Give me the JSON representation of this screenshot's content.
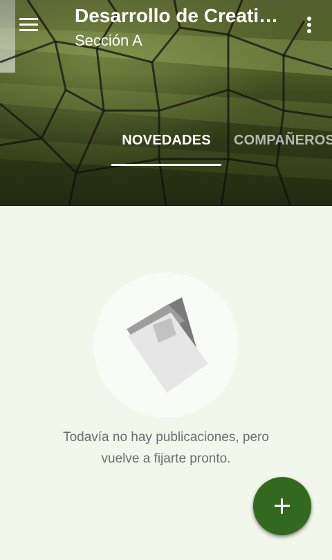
{
  "header": {
    "title": "Desarrollo de Creati…",
    "subtitle": "Sección A",
    "menu_icon": "menu-icon",
    "overflow_icon": "more-vert-icon",
    "background_image": "soccer-goal-net-photo"
  },
  "tabs": [
    {
      "label": "NOVEDADES",
      "selected": true
    },
    {
      "label": "COMPAÑEROS",
      "selected": false
    }
  ],
  "empty_state": {
    "illustration_icon": "posts-empty-icon",
    "message_line1": "Todavía no hay publicaciones, pero",
    "message_line2": "vuelve a fijarte pronto."
  },
  "fab": {
    "icon": "plus-icon",
    "color": "#33691e"
  },
  "colors": {
    "background": "#f1f7ea",
    "accent": "#33691e"
  }
}
